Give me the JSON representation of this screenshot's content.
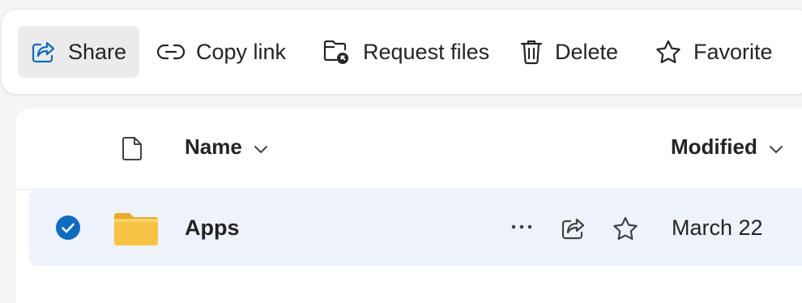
{
  "toolbar": {
    "share_label": "Share",
    "copy_link_label": "Copy link",
    "request_files_label": "Request files",
    "delete_label": "Delete",
    "favorite_label": "Favorite"
  },
  "list": {
    "headers": {
      "name": "Name",
      "modified": "Modified"
    },
    "rows": [
      {
        "name": "Apps",
        "modified": "March 22",
        "selected": true,
        "type_icon": "folder-icon"
      }
    ]
  },
  "colors": {
    "accent": "#0f6cbd",
    "selected_row_bg": "#eef3fb",
    "folder_yellow": "#f6c344",
    "active_button_bg": "#ebebeb"
  }
}
